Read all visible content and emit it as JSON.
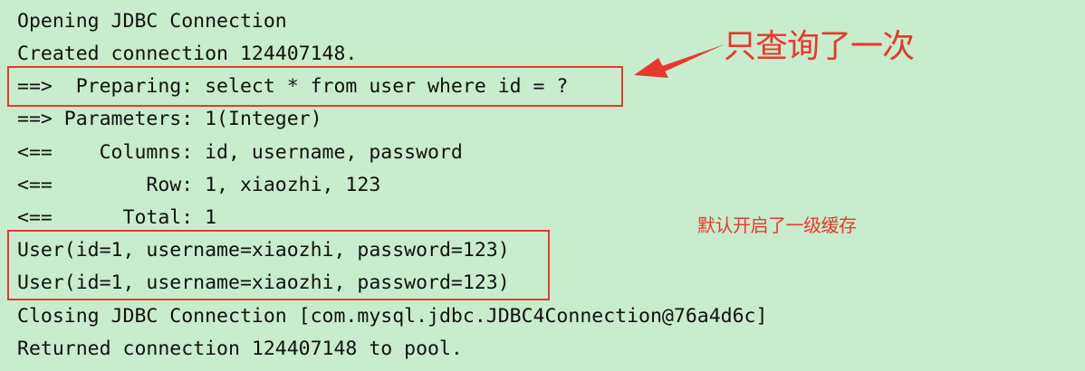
{
  "console": {
    "lines": [
      "Opening JDBC Connection",
      "Created connection 124407148.",
      "==>  Preparing: select * from user where id = ? ",
      "==> Parameters: 1(Integer)",
      "<==    Columns: id, username, password",
      "<==        Row: 1, xiaozhi, 123",
      "<==      Total: 1",
      "User(id=1, username=xiaozhi, password=123)",
      "User(id=1, username=xiaozhi, password=123)",
      "Closing JDBC Connection [com.mysql.jdbc.JDBC4Connection@76a4d6c]",
      "Returned connection 124407148 to pool."
    ]
  },
  "annotations": {
    "query_once": "只查询了一次",
    "first_level_cache": "默认开启了一级缓存"
  },
  "colors": {
    "background": "#C7EDCC",
    "text": "#111111",
    "annotation": "#E8382E"
  }
}
